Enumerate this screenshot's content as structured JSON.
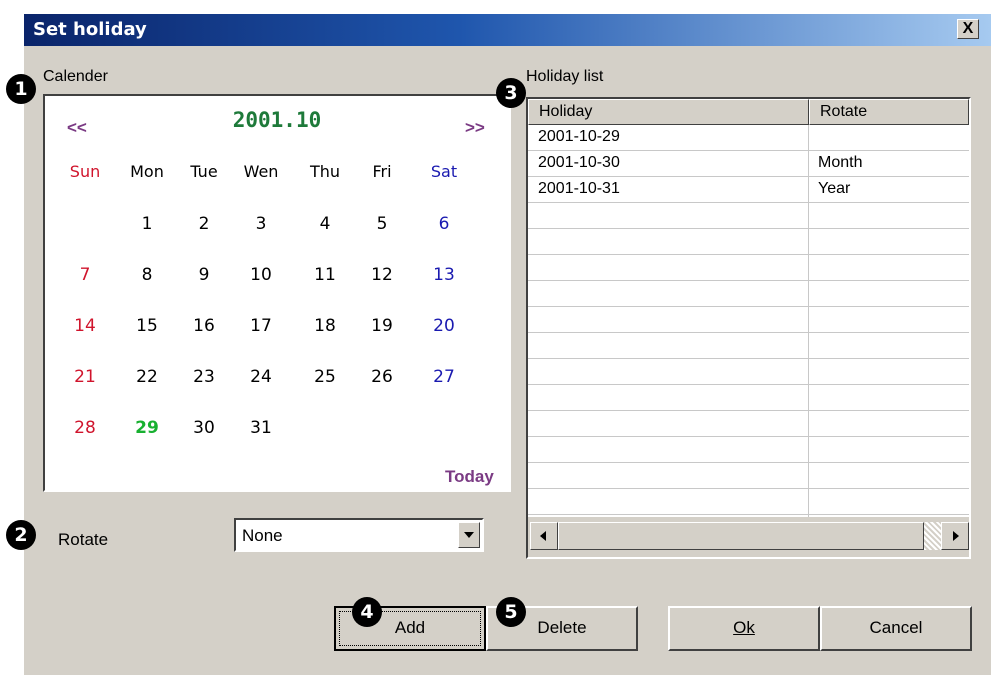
{
  "window": {
    "title": "Set holiday",
    "close_label": "X"
  },
  "calendar": {
    "group_label": "Calender",
    "prev_label": "<<",
    "next_label": ">>",
    "month": "2001.10",
    "today_label": "Today",
    "weekdays": [
      "Sun",
      "Mon",
      "Tue",
      "Wen",
      "Thu",
      "Fri",
      "Sat"
    ],
    "weeks": [
      [
        "",
        "1",
        "2",
        "3",
        "4",
        "5",
        "6"
      ],
      [
        "7",
        "8",
        "9",
        "10",
        "11",
        "12",
        "13"
      ],
      [
        "14",
        "15",
        "16",
        "17",
        "18",
        "19",
        "20"
      ],
      [
        "21",
        "22",
        "23",
        "24",
        "25",
        "26",
        "27"
      ],
      [
        "28",
        "29",
        "30",
        "31",
        "",
        "",
        ""
      ]
    ],
    "highlighted_day": "29",
    "colors": {
      "sunday": "#d0142c",
      "saturday": "#1a1ab0",
      "today": "#18b030",
      "month": "#1e7a3a",
      "nav": "#7b3b84"
    }
  },
  "rotate": {
    "label": "Rotate",
    "value": "None"
  },
  "holiday_list": {
    "group_label": "Holiday list",
    "columns": [
      "Holiday",
      "Rotate"
    ],
    "rows": [
      [
        "2001-10-29",
        ""
      ],
      [
        "2001-10-30",
        "Month"
      ],
      [
        "2001-10-31",
        "Year"
      ],
      [
        "",
        ""
      ],
      [
        "",
        ""
      ],
      [
        "",
        ""
      ],
      [
        "",
        ""
      ],
      [
        "",
        ""
      ],
      [
        "",
        ""
      ],
      [
        "",
        ""
      ],
      [
        "",
        ""
      ],
      [
        "",
        ""
      ],
      [
        "",
        ""
      ],
      [
        "",
        ""
      ],
      [
        "",
        ""
      ],
      [
        "",
        ""
      ]
    ]
  },
  "buttons": {
    "add": "Add",
    "delete": "Delete",
    "ok": "Ok",
    "cancel": "Cancel"
  },
  "callouts": [
    "1",
    "2",
    "3",
    "4",
    "5"
  ]
}
